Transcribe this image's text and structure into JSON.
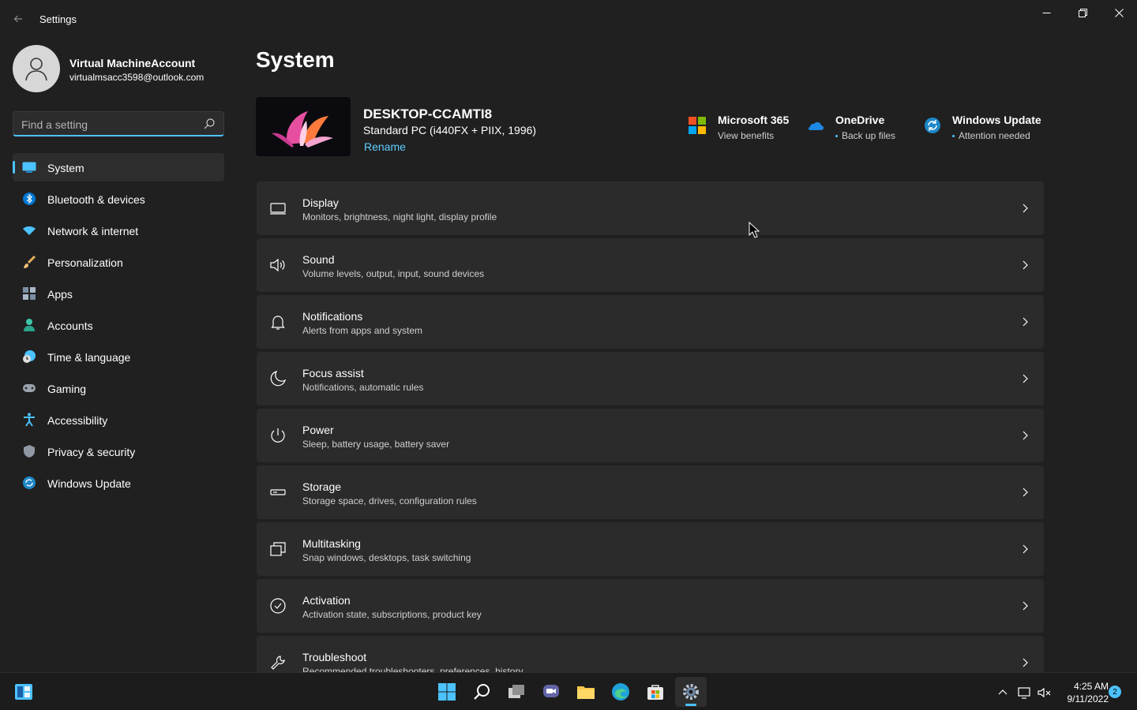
{
  "window": {
    "title": "Settings"
  },
  "profile": {
    "name": "Virtual MachineAccount",
    "email": "virtualmsacc3598@outlook.com"
  },
  "search": {
    "placeholder": "Find a setting"
  },
  "nav": {
    "items": [
      {
        "label": "System",
        "icon": "system-icon"
      },
      {
        "label": "Bluetooth & devices",
        "icon": "bluetooth-icon"
      },
      {
        "label": "Network & internet",
        "icon": "wifi-icon"
      },
      {
        "label": "Personalization",
        "icon": "brush-icon"
      },
      {
        "label": "Apps",
        "icon": "apps-icon"
      },
      {
        "label": "Accounts",
        "icon": "accounts-icon"
      },
      {
        "label": "Time & language",
        "icon": "clock-globe-icon"
      },
      {
        "label": "Gaming",
        "icon": "gamepad-icon"
      },
      {
        "label": "Accessibility",
        "icon": "accessibility-icon"
      },
      {
        "label": "Privacy & security",
        "icon": "shield-icon"
      },
      {
        "label": "Windows Update",
        "icon": "update-icon"
      }
    ],
    "selected": "System"
  },
  "main": {
    "title": "System",
    "device": {
      "name": "DESKTOP-CCAMTI8",
      "spec": "Standard PC (i440FX + PIIX, 1996)",
      "rename": "Rename"
    },
    "quick": [
      {
        "title": "Microsoft 365",
        "sub": "View benefits",
        "icon": "microsoft-365-icon"
      },
      {
        "title": "OneDrive",
        "sub": "Back up files",
        "icon": "onedrive-icon"
      },
      {
        "title": "Windows Update",
        "sub": "Attention needed",
        "icon": "windows-update-icon"
      }
    ],
    "cards": [
      {
        "title": "Display",
        "desc": "Monitors, brightness, night light, display profile",
        "icon": "display-icon"
      },
      {
        "title": "Sound",
        "desc": "Volume levels, output, input, sound devices",
        "icon": "speaker-icon"
      },
      {
        "title": "Notifications",
        "desc": "Alerts from apps and system",
        "icon": "bell-icon"
      },
      {
        "title": "Focus assist",
        "desc": "Notifications, automatic rules",
        "icon": "moon-icon"
      },
      {
        "title": "Power",
        "desc": "Sleep, battery usage, battery saver",
        "icon": "power-icon"
      },
      {
        "title": "Storage",
        "desc": "Storage space, drives, configuration rules",
        "icon": "storage-icon"
      },
      {
        "title": "Multitasking",
        "desc": "Snap windows, desktops, task switching",
        "icon": "multitasking-icon"
      },
      {
        "title": "Activation",
        "desc": "Activation state, subscriptions, product key",
        "icon": "check-circle-icon"
      },
      {
        "title": "Troubleshoot",
        "desc": "Recommended troubleshooters, preferences, history",
        "icon": "wrench-icon"
      }
    ]
  },
  "taskbar": {
    "clock": {
      "time": "4:25 AM",
      "date": "9/11/2022"
    },
    "notification_count": "2"
  },
  "colors": {
    "accent": "#4cc2ff",
    "link": "#60cdff",
    "background": "#202020",
    "card": "#2b2b2b"
  }
}
